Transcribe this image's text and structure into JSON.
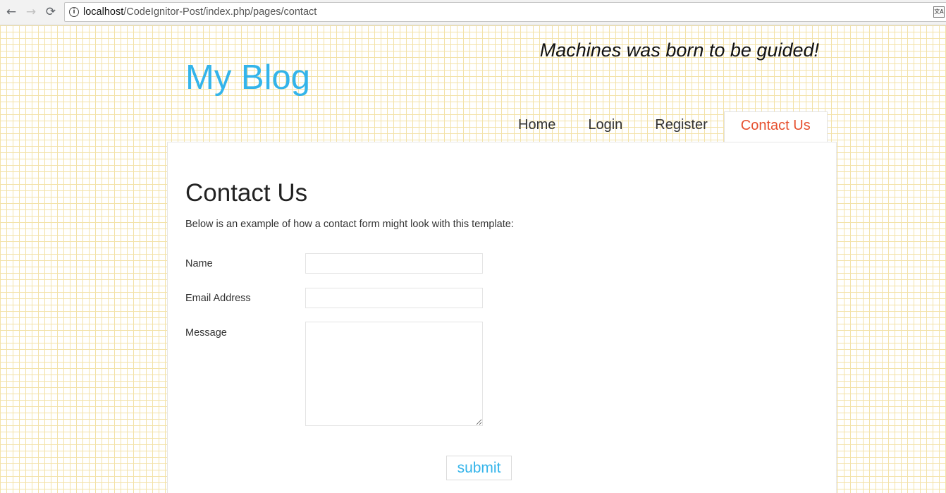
{
  "browser": {
    "back_icon": "←",
    "forward_icon": "→",
    "reload_icon": "⟳",
    "info_icon": "i",
    "url_host": "localhost",
    "url_path": "/CodeIgnitor-Post/index.php/pages/contact",
    "translate_icon": "文A"
  },
  "header": {
    "tagline": "Machines was born to be guided!",
    "site_title": "My Blog"
  },
  "nav": {
    "items": [
      {
        "label": "Home"
      },
      {
        "label": "Login"
      },
      {
        "label": "Register"
      },
      {
        "label": "Contact Us",
        "active": true
      }
    ]
  },
  "main": {
    "heading": "Contact Us",
    "intro": "Below is an example of how a contact form might look with this template:",
    "form": {
      "name_label": "Name",
      "name_value": "",
      "email_label": "Email Address",
      "email_value": "",
      "message_label": "Message",
      "message_value": "",
      "submit_label": "submit"
    }
  },
  "colors": {
    "title_blue": "#33b4ea",
    "active_tab": "#e6502f",
    "grid_line": "#f3e2a8"
  }
}
